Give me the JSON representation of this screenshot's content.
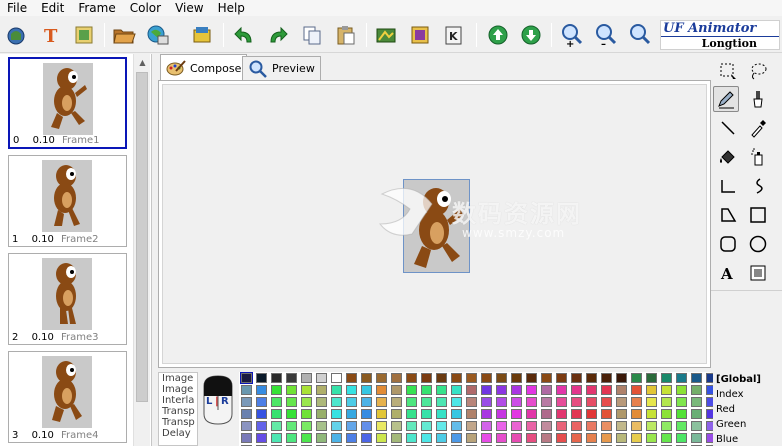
{
  "menu": [
    "File",
    "Edit",
    "Frame",
    "Color",
    "View",
    "Help"
  ],
  "logo": {
    "line1": "UF Animator",
    "line2": "Longtion"
  },
  "tabs": {
    "compose": "Compose",
    "preview": "Preview"
  },
  "frames": [
    {
      "index": "0",
      "delay": "0.10",
      "name": "Frame1"
    },
    {
      "index": "1",
      "delay": "0.10",
      "name": "Frame2"
    },
    {
      "index": "2",
      "delay": "0.10",
      "name": "Frame3"
    },
    {
      "index": "3",
      "delay": "0.10",
      "name": "Frame4"
    }
  ],
  "info_labels": [
    "Image",
    "Image",
    "Interla",
    "Transp",
    "Transp",
    "Delay"
  ],
  "mouse": {
    "left": "L",
    "right": "R"
  },
  "global_panel": {
    "header": "[Global]",
    "rows": [
      "Index",
      "Red",
      "Green",
      "Blue"
    ]
  },
  "watermark": {
    "text": "数码资源网",
    "url": "www.smzy.com"
  },
  "colors": {
    "selection": "#0a16b7",
    "accent": "#1b3c9b"
  }
}
